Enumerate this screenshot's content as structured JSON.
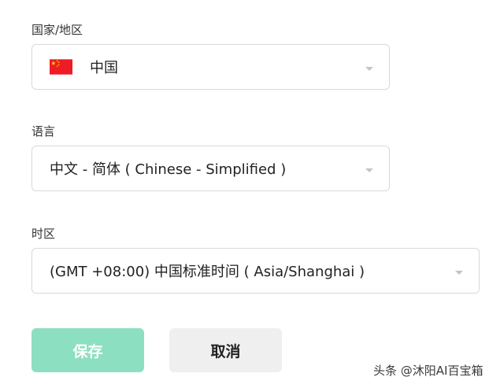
{
  "country": {
    "label": "国家/地区",
    "value": "中国",
    "flag_icon": "china-flag-icon",
    "caret_icon": "chevron-down-icon"
  },
  "language": {
    "label": "语言",
    "value": "中文 - 简体 (  Chinese - Simplified  )",
    "caret_icon": "chevron-down-icon"
  },
  "timezone": {
    "label": "时区",
    "value": "(GMT +08:00) 中国标准时间 ( Asia/Shanghai )",
    "caret_icon": "chevron-down-icon"
  },
  "actions": {
    "save_label": "保存",
    "cancel_label": "取消"
  },
  "watermark": "头条 @沐阳AI百宝箱",
  "colors": {
    "save_bg": "#8ddfc1",
    "cancel_bg": "#efefef",
    "border": "#d9d9d9",
    "flag_red": "#ee1c25",
    "flag_star": "#ffde00"
  }
}
